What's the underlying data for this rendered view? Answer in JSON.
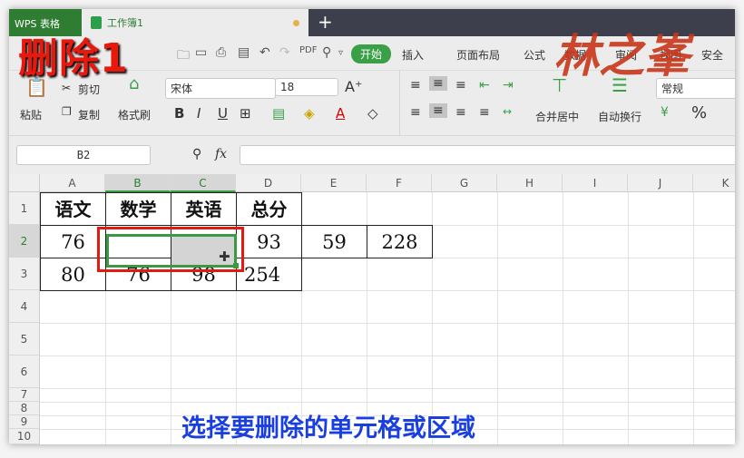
{
  "overlay_title": "删除1",
  "logo_text": "林之峯",
  "caption": "选择要删除的单元格或区域",
  "tabs": {
    "app": "WPS 表格",
    "workbook": "工作簿1",
    "new": "+"
  },
  "menu": [
    "开始",
    "插入",
    "页面布局",
    "公式",
    "数据",
    "审阅",
    "视图",
    "安全"
  ],
  "ribbon": {
    "paste": "粘贴",
    "cut": "剪切",
    "copy": "复制",
    "format_painter": "格式刷",
    "font": "宋体",
    "size": "18",
    "merge": "合并居中",
    "wrap": "自动换行",
    "number_format": "常规",
    "bold": "B",
    "italic": "I",
    "underline": "U",
    "percent": "%"
  },
  "formula_bar": {
    "name_box": "B2",
    "fx": "fx",
    "value": ""
  },
  "columns": [
    "A",
    "B",
    "C",
    "D",
    "E",
    "F",
    "G",
    "H",
    "I",
    "J",
    "K"
  ],
  "rows": [
    "1",
    "2",
    "3",
    "4",
    "5",
    "6",
    "7",
    "8",
    "9",
    "10"
  ],
  "cells": {
    "A1": "语文",
    "B1": "数学",
    "C1": "英语",
    "D1": "总分",
    "A2": "76",
    "B2": "",
    "C2": "",
    "D2": "93",
    "E2": "59",
    "F2": "228",
    "A3": "80",
    "B3": "76",
    "C3": "98",
    "D3": "254"
  },
  "colors": {
    "accent": "#3aa048",
    "selection": "#3a9a44",
    "highlight": "#e8180c",
    "caption": "#1a3fe0"
  }
}
